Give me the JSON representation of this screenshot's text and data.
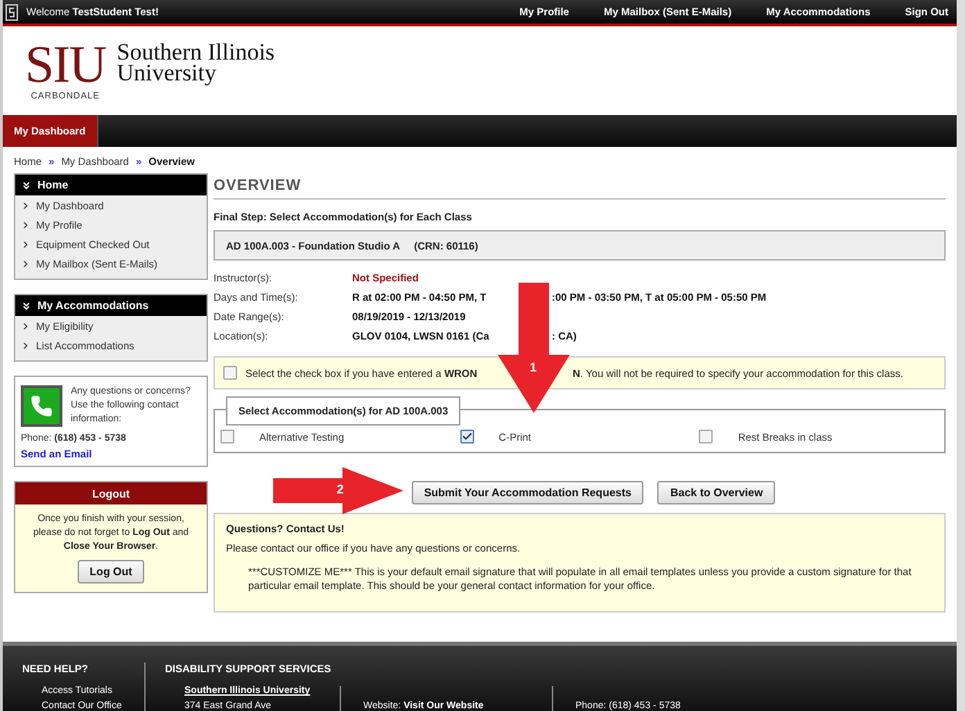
{
  "top_bar": {
    "welcome": "Welcome **TestStudent Test!**",
    "links": [
      "My Profile",
      "My Mailbox (Sent E-Mails)",
      "My Accommodations",
      "Sign Out"
    ]
  },
  "logo": {
    "mark": "SIU",
    "campus": "CARBONDALE",
    "name": [
      "Southern Illinois",
      "University"
    ]
  },
  "nav_tabs": [
    {
      "label": "My Dashboard",
      "selected": true
    }
  ],
  "breadcrumb": [
    {
      "kind": "link",
      "label": "Home"
    },
    {
      "kind": "separator",
      "label": "»"
    },
    {
      "kind": "link",
      "label": "My Dashboard"
    },
    {
      "kind": "separator",
      "label": "»"
    },
    {
      "kind": "current",
      "label": "Overview"
    }
  ],
  "sidebar": {
    "menus": [
      {
        "title": "Home",
        "items": [
          "My Dashboard",
          "My Profile",
          "Equipment Checked Out",
          "My Mailbox (Sent E-Mails)"
        ]
      },
      {
        "title": "My Accommodations",
        "items": [
          "My Eligibility",
          "List Accommodations"
        ]
      }
    ],
    "contact": {
      "text": "Any questions or concerns? Use the following contact information:",
      "phone": "Phone: **(618) 453 - 5738**",
      "email_link": "Send an Email"
    },
    "logout": {
      "title": "Logout",
      "message": "Once you finish with your session, please do not forget to **Log Out** and **Close Your Browser**.",
      "button": "Log Out"
    }
  },
  "main": {
    "title": "OVERVIEW",
    "step": "Final Step: Select Accommodation(s) for Each Class",
    "class_heading": "AD 100A.003 - Foundation Studio A",
    "crn": "(CRN: 60116)",
    "details": [
      {
        "label": "Instructor(s):",
        "kind": "alert",
        "value": "Not Specified"
      },
      {
        "label": "Days and Time(s):",
        "kind": "split",
        "parts": [
          "R at 02:00 PM - 04:50 PM, T",
          ":00 PM - 03:50 PM, T at 05:00 PM - 05:50 PM"
        ]
      },
      {
        "label": "Date Range(s):",
        "kind": "plain",
        "value": "08/19/2019 - 12/13/2019"
      },
      {
        "label": "Location(s):",
        "kind": "split",
        "parts": [
          "GLOV 0104, LWSN 0161 (Ca",
          ": CA)"
        ]
      }
    ],
    "wrong_crn": {
      "checked": false,
      "parts": [
        "Select the check box if you have entered a **WRON**",
        "**N**. You will not be required to specify your accommodation for this class."
      ]
    },
    "accommodations": {
      "legend": "Select Accommodation(s) for AD 100A.003",
      "options": [
        {
          "label": "Alternative Testing",
          "checked": false
        },
        {
          "label": "C-Print",
          "checked": true
        },
        {
          "label": "Rest Breaks in class",
          "checked": false
        }
      ]
    },
    "buttons": [
      "Submit Your Accommodation Requests",
      "Back to Overview"
    ],
    "contact_box": {
      "title": "Questions? Contact Us!",
      "intro": "Please contact our office if you have any questions or concerns.",
      "signature": "***CUSTOMIZE ME*** This is your default email signature that will populate in all email templates unless you provide a custom signature for that particular email template. This should be your general contact information for your office."
    }
  },
  "annotations": [
    {
      "kind": "down",
      "number": "1"
    },
    {
      "kind": "right",
      "number": "2"
    }
  ],
  "footer": {
    "help": {
      "heading": "NEED HELP?",
      "links": [
        "Access Tutorials",
        "Contact Our Office"
      ]
    },
    "dss": {
      "heading": "DISABILITY SUPPORT SERVICES",
      "groups": [
        {
          "lines": [
            {
              "kind": "title",
              "text": "Southern Illinois University"
            },
            {
              "kind": "text",
              "text": "374 East Grand Ave"
            }
          ]
        },
        {
          "lines": [
            {
              "kind": "text",
              "text": "Website: **Visit Our Website**"
            }
          ]
        },
        {
          "lines": [
            {
              "kind": "text",
              "text": "Phone: (618) 453 - 5738"
            }
          ]
        }
      ]
    }
  }
}
